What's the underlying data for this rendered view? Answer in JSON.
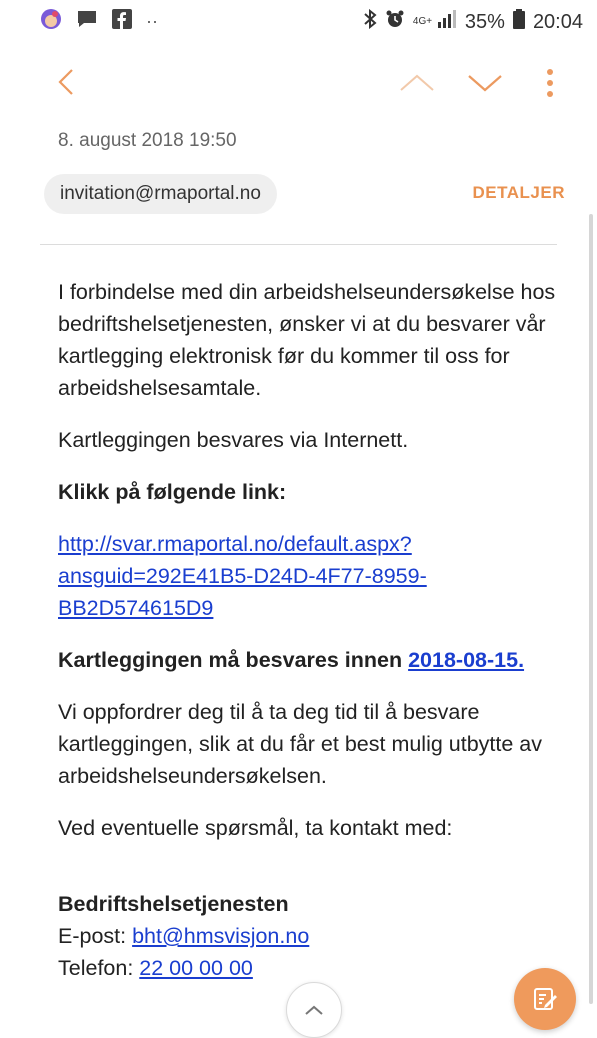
{
  "status_bar": {
    "battery_percent": "35%",
    "time": "20:04",
    "network": "4G+",
    "more_dots": "··"
  },
  "email": {
    "date": "8. august 2018  19:50",
    "sender": "invitation@rmaportal.no",
    "details_label": "DETALJER",
    "body": {
      "p1": "I forbindelse med din arbeidshelseundersøkelse hos bedriftshelsetjenesten, ønsker vi at du besvarer vår kartlegging elektronisk før du kommer til oss for arbeidshelsesamtale.",
      "p2": "Kartleggingen besvares via Internett.",
      "p3": "Klikk på følgende link:",
      "link_line1": "http://svar.rmaportal.no/default.aspx?",
      "link_line2": "ansguid=292E41B5-D24D-4F77-8959-",
      "link_line3": "BB2D574615D9",
      "deadline_text": "Kartleggingen må besvares innen ",
      "deadline_date": "2018-08-15.",
      "p5": "Vi oppfordrer deg til å ta deg tid til å besvare kartleggingen, slik at du får et best mulig utbytte av arbeidshelseundersøkelsen.",
      "p6": "Ved eventuelle spørsmål, ta kontakt med:",
      "contact_org": "Bedriftshelsetjenesten",
      "email_label": "E-post: ",
      "email_value": "bht@hmsvisjon.no",
      "phone_label": "Telefon: ",
      "phone_value": "22 00 00 00"
    }
  },
  "colors": {
    "accent": "#e9914f",
    "link": "#1a3ecf",
    "fab": "#ef9a5c"
  },
  "icons": [
    "bitmoji-icon",
    "message-icon",
    "facebook-icon",
    "bluetooth-icon",
    "alarm-icon",
    "signal-icon",
    "battery-icon",
    "back-icon",
    "previous-icon",
    "next-icon",
    "more-icon",
    "compose-icon",
    "scroll-top-icon"
  ]
}
